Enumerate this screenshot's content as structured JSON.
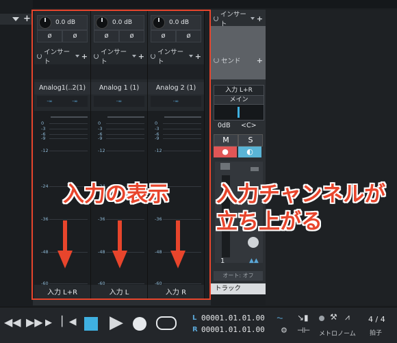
{
  "channels": [
    {
      "name": "Analog1(..2(1)",
      "gain": "0.0 dB",
      "phase": [
        "ø",
        "ø"
      ],
      "insert": "インサート",
      "pan": [
        "-∞",
        "-∞"
      ],
      "input": "入力 L+R"
    },
    {
      "name": "Analog 1 (1)",
      "gain": "0.0 dB",
      "phase": [
        "ø",
        "ø"
      ],
      "insert": "インサート",
      "pan": [
        "-∞"
      ],
      "input": "入力 L"
    },
    {
      "name": "Analog 2 (1)",
      "gain": "0.0 dB",
      "phase": [
        "ø",
        "ø"
      ],
      "insert": "インサート",
      "pan": [
        "-∞"
      ],
      "input": "入力 R"
    }
  ],
  "meter_scale": [
    "0",
    "-3",
    "-6",
    "-9",
    "-12",
    "-24",
    "-36",
    "-48",
    "-60"
  ],
  "right_panel": {
    "insert": "インサート",
    "send": "センド",
    "io_input": "入力 L+R",
    "io_output": "メイン",
    "volume": "0dB",
    "pan": "<C>",
    "mute": "M",
    "solo": "S",
    "channel_number": "1",
    "automation": "オート: オフ",
    "track_label": "トラック"
  },
  "annotations": {
    "input_display": "入力の表示",
    "input_channel_line1": "入力チャンネルが",
    "input_channel_line2": "立ち上がる"
  },
  "transport": {
    "time_l": "00001.01.01.00",
    "time_r": "00001.01.01.00",
    "l_label": "L",
    "r_label": "R",
    "metronome": "メトロノーム",
    "time_sig": "4 / 4",
    "time_sig_label": "拍子"
  },
  "colors": {
    "accent": "#3fb0e0",
    "annotation": "#e8452c",
    "mute": "#e05656",
    "solo": "#5ab4d6"
  }
}
